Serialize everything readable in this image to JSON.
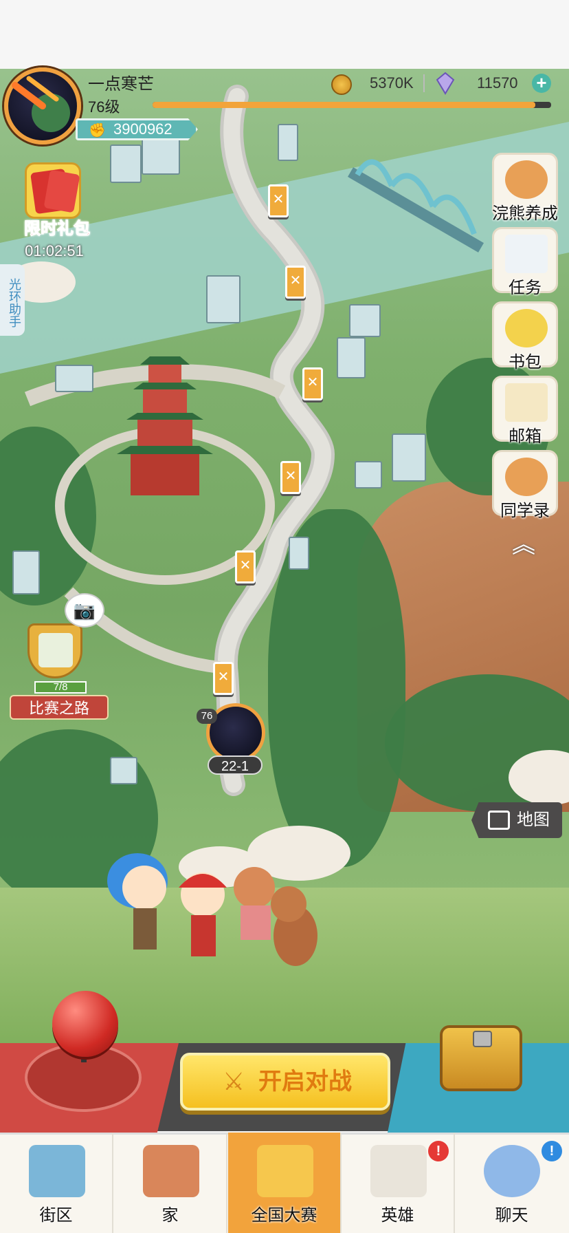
{
  "player": {
    "name": "一点寒芒",
    "level": "76级",
    "combat_power": "3900962",
    "xp_fraction": 0.96
  },
  "currencies": {
    "coins": "5370K",
    "gems": "11570"
  },
  "left_widgets": {
    "gift_pack_label": "限时礼包",
    "gift_pack_timer": "01:02:51",
    "halo_assistant": "光环助手",
    "cup_progress": "7/8",
    "cup_label": "比赛之路"
  },
  "right_menu": [
    {
      "label": "浣熊养成",
      "icon": "raccoon-icon"
    },
    {
      "label": "任务",
      "icon": "clipboard-icon"
    },
    {
      "label": "书包",
      "icon": "backpack-icon"
    },
    {
      "label": "邮箱",
      "icon": "envelope-icon"
    },
    {
      "label": "同学录",
      "icon": "classmate-icon"
    }
  ],
  "stage": {
    "player_level": "76",
    "current_stage": "22-1"
  },
  "map_button": "地图",
  "battle_button": "开启对战",
  "nav": [
    {
      "label": "街区",
      "icon": "signpost-icon",
      "active": false,
      "badge": ""
    },
    {
      "label": "家",
      "icon": "house-icon",
      "active": false,
      "badge": ""
    },
    {
      "label": "全国大赛",
      "icon": "trophy-icon",
      "active": true,
      "badge": ""
    },
    {
      "label": "英雄",
      "icon": "cards-icon",
      "active": false,
      "badge": "!"
    },
    {
      "label": "聊天",
      "icon": "chat-bubble-icon",
      "active": false,
      "badge": "!"
    }
  ],
  "colors": {
    "accent_orange": "#f2a33c",
    "battle_button": "#f5c020",
    "alert_red": "#e53935",
    "alert_blue": "#2f8be0"
  }
}
